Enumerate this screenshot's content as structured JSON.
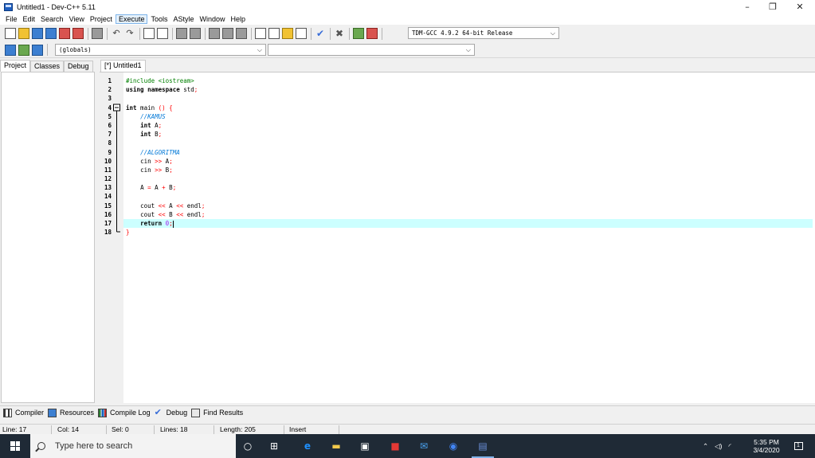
{
  "window": {
    "title": "Untitled1 - Dev-C++ 5.11",
    "minimize": "–",
    "maximize": "❐",
    "close": "✕"
  },
  "menu": [
    "File",
    "Edit",
    "Search",
    "View",
    "Project",
    "Execute",
    "Tools",
    "AStyle",
    "Window",
    "Help"
  ],
  "menu_active": "Execute",
  "toolbar": {
    "compiler_select": "TDM-GCC 4.9.2 64-bit Release",
    "scope_select": "(globals)",
    "function_select": ""
  },
  "left_tabs": [
    "Project",
    "Classes",
    "Debug"
  ],
  "editor": {
    "tab": "[*] Untitled1",
    "line_numbers": [
      "1",
      "2",
      "3",
      "4",
      "5",
      "6",
      "7",
      "8",
      "9",
      "10",
      "11",
      "12",
      "13",
      "14",
      "15",
      "16",
      "17",
      "18"
    ]
  },
  "code": {
    "l1": "#include <iostream>",
    "l2_kw": "using namespace",
    "l2_rest": " std",
    "l4_kw": "int",
    "l4_rest": " main ",
    "l4_paren": "() {",
    "l5": "//KAMUS",
    "l6_kw": "int",
    "l6_rest": " A",
    "l7_kw": "int",
    "l7_rest": " B",
    "l9": "//ALGORITMA",
    "l10_a": "cin ",
    "l10_op": ">>",
    "l10_b": " A",
    "l11_a": "cin ",
    "l11_op": ">>",
    "l11_b": " B",
    "l13_a": "A ",
    "l13_eq": "=",
    "l13_b": " A ",
    "l13_plus": "+",
    "l13_c": " B",
    "l15_a": "cout ",
    "l15_op1": "<<",
    "l15_b": " A ",
    "l15_op2": "<<",
    "l15_c": " endl",
    "l16_a": "cout ",
    "l16_op1": "<<",
    "l16_b": " B ",
    "l16_op2": "<<",
    "l16_c": " endl",
    "l17_kw": "return",
    "l17_num": "0",
    "semi": ";",
    "brace_close": "}"
  },
  "bottom_tabs": [
    "Compiler",
    "Resources",
    "Compile Log",
    "Debug",
    "Find Results"
  ],
  "status": {
    "line": "Line:   17",
    "col": "Col:   14",
    "sel": "Sel:   0",
    "lines": "Lines:   18",
    "length": "Length:   205",
    "mode": "Insert"
  },
  "taskbar": {
    "search_placeholder": "Type here to search",
    "time": "5:35 PM",
    "date": "3/4/2020",
    "notifications": "1"
  }
}
